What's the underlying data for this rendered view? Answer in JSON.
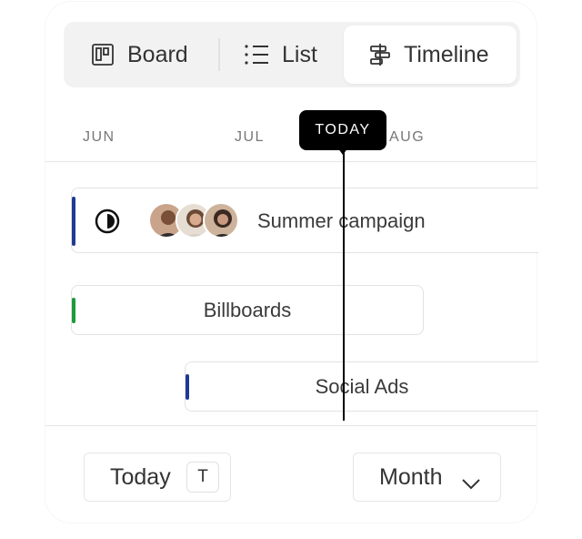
{
  "views": {
    "board": "Board",
    "list": "List",
    "timeline": "Timeline",
    "active": "timeline"
  },
  "timeline": {
    "months": [
      "JUN",
      "JUL",
      "AUG"
    ],
    "today_marker": "TODAY"
  },
  "bars": [
    {
      "label": "Summer campaign",
      "accent": "#1f3a93",
      "avatars": [
        "person",
        "person",
        "person"
      ]
    },
    {
      "label": "Billboards",
      "accent": "#1e9a3c"
    },
    {
      "label": "Social Ads",
      "accent": "#1f3a93"
    }
  ],
  "controls": {
    "today_label": "Today",
    "today_shortcut": "T",
    "scale_label": "Month"
  },
  "icons": {
    "board": "board-icon",
    "list": "list-icon",
    "timeline": "timeline-icon",
    "progress": "half-circle-progress-icon",
    "chevron": "chevron-down-icon"
  }
}
